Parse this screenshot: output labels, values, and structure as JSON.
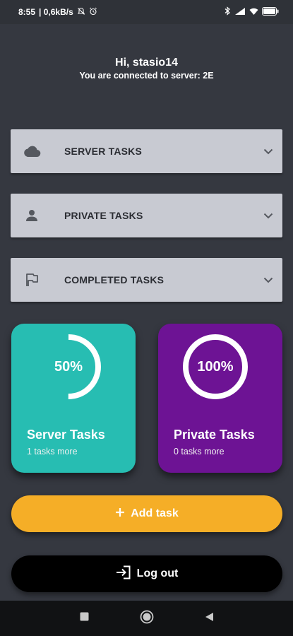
{
  "status_bar": {
    "time": "8:55",
    "net_speed": "| 0,6kB/s",
    "battery": "85"
  },
  "header": {
    "greeting": "Hi, stasio14",
    "server_info": "You are connected to server: 2E"
  },
  "sections": [
    {
      "label": "SERVER TASKS",
      "icon": "cloud-icon"
    },
    {
      "label": "PRIVATE TASKS",
      "icon": "person-icon"
    },
    {
      "label": "COMPLETED TASKS",
      "icon": "flag-icon"
    }
  ],
  "cards": [
    {
      "title": "Server Tasks",
      "subtitle": "1 tasks more",
      "percent_label": "50%",
      "progress": 0.5,
      "color": "#27bdb2"
    },
    {
      "title": "Private Tasks",
      "subtitle": "0 tasks more",
      "percent_label": "100%",
      "progress": 1.0,
      "color": "#6d1394"
    }
  ],
  "buttons": {
    "add_task": "Add task",
    "add_task_color": "#f5ae27",
    "logout": "Log out",
    "logout_color": "#000000"
  },
  "colors": {
    "background": "#353840",
    "panel": "#c8cad2"
  }
}
